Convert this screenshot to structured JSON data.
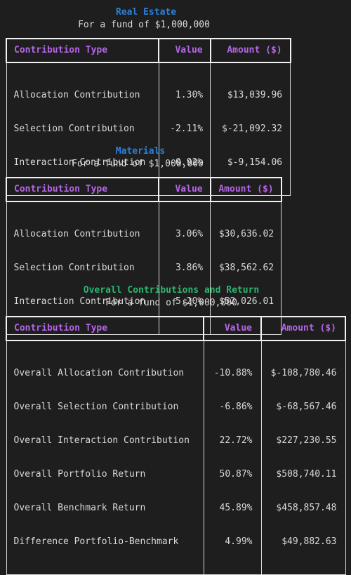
{
  "colors": {
    "background": "#1e1e1e",
    "text": "#d9d9d9",
    "header_text": "#b565e6",
    "title_blue": "#2b7fd8",
    "title_green": "#2bb56f"
  },
  "sections": [
    {
      "title": "Real Estate",
      "subtitle": "For a fund of $1,000,000",
      "headers": [
        "Contribution Type",
        "Value",
        "Amount ($)"
      ],
      "rows": [
        [
          "Allocation Contribution",
          "1.30%",
          "$13,039.96"
        ],
        [
          "Selection Contribution",
          "-2.11%",
          "$-21,092.32"
        ],
        [
          "Interaction Contribution",
          "-0.92%",
          "$-9,154.06"
        ]
      ]
    },
    {
      "title": "Materials",
      "subtitle": "For a fund of $1,000,000",
      "headers": [
        "Contribution Type",
        "Value",
        "Amount ($)"
      ],
      "rows": [
        [
          "Allocation Contribution",
          "3.06%",
          "$30,636.02"
        ],
        [
          "Selection Contribution",
          "3.86%",
          "$38,562.62"
        ],
        [
          "Interaction Contribution",
          "5.20%",
          "$52,026.01"
        ]
      ]
    },
    {
      "title": "Overall Contributions and Return",
      "subtitle": "For a fund of $1,000,000",
      "headers": [
        "Contribution Type",
        "Value",
        "Amount ($)"
      ],
      "rows": [
        [
          "Overall Allocation Contribution",
          "-10.88%",
          "$-108,780.46"
        ],
        [
          "Overall Selection Contribution",
          "-6.86%",
          "$-68,567.46"
        ],
        [
          "Overall Interaction Contribution",
          "22.72%",
          "$227,230.55"
        ],
        [
          "Overall Portfolio Return",
          "50.87%",
          "$508,740.11"
        ],
        [
          "Overall Benchmark Return",
          "45.89%",
          "$458,857.48"
        ],
        [
          "Difference Portfolio-Benchmark",
          "4.99%",
          "$49,882.63"
        ]
      ]
    }
  ]
}
